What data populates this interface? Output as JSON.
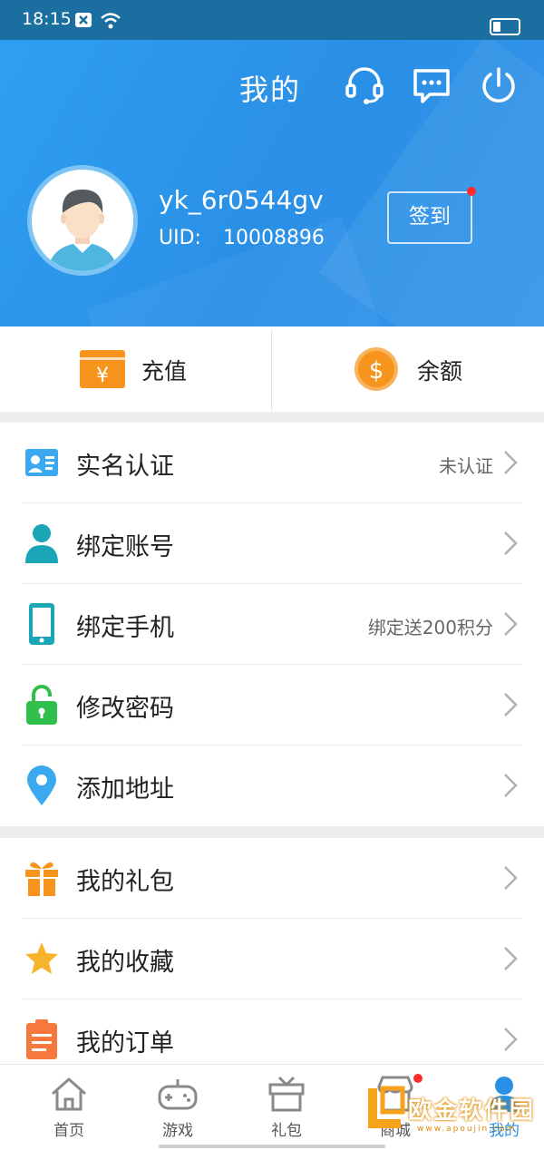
{
  "status_bar": {
    "time": "18:15"
  },
  "header": {
    "title": "我的",
    "username": "yk_6r0544gv",
    "uid_label": "UID:",
    "uid_value": "10008896",
    "signin_label": "签到"
  },
  "wallet": {
    "recharge_label": "充值",
    "balance_label": "余额",
    "recharge_icon_glyph": "¥",
    "balance_icon_glyph": "$"
  },
  "menu_group_1": [
    {
      "label": "实名认证",
      "value": "未认证",
      "icon": "id-card-icon"
    },
    {
      "label": "绑定账号",
      "value": "",
      "icon": "user-icon"
    },
    {
      "label": "绑定手机",
      "value": "绑定送200积分",
      "icon": "phone-icon"
    },
    {
      "label": "修改密码",
      "value": "",
      "icon": "lock-icon"
    },
    {
      "label": "添加地址",
      "value": "",
      "icon": "location-pin-icon"
    }
  ],
  "menu_group_2": [
    {
      "label": "我的礼包",
      "icon": "gift-icon"
    },
    {
      "label": "我的收藏",
      "icon": "star-icon"
    },
    {
      "label": "我的订单",
      "icon": "clipboard-icon"
    }
  ],
  "tabbar": {
    "tabs": [
      {
        "label": "首页",
        "icon": "home-icon"
      },
      {
        "label": "游戏",
        "icon": "gamepad-icon"
      },
      {
        "label": "礼包",
        "icon": "gift-box-icon"
      },
      {
        "label": "商城",
        "icon": "shop-icon"
      },
      {
        "label": "我的",
        "icon": "profile-icon"
      }
    ]
  },
  "watermark": {
    "text": "欧金软件园",
    "sub": "www.apoujin.com"
  },
  "colors": {
    "header_blue": "#2a8fe6",
    "accent_orange": "#f7941d",
    "accent_teal": "#1aa6b7",
    "accent_green": "#2fbf4a",
    "accent_blue": "#3aa9f0",
    "notify_red": "#ff2a2a"
  }
}
